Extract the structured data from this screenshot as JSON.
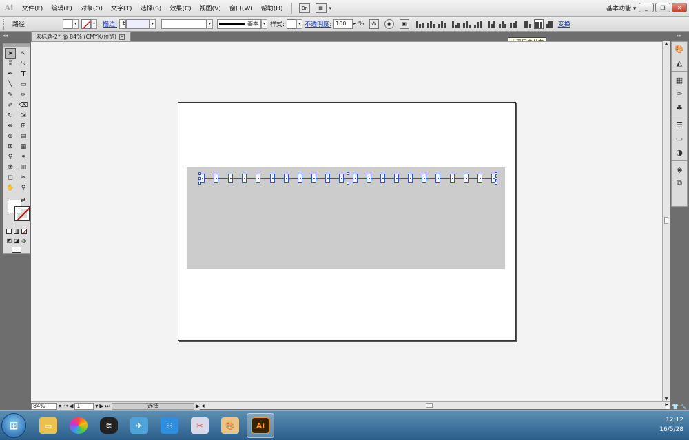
{
  "app": {
    "logo": "Ai"
  },
  "menu": [
    "文件(F)",
    "编辑(E)",
    "对象(O)",
    "文字(T)",
    "选择(S)",
    "效果(C)",
    "视图(V)",
    "窗口(W)",
    "帮助(H)"
  ],
  "menu_icons": [
    "Br",
    "arrange-documents-icon"
  ],
  "workspace": {
    "label": "基本功能",
    "arrow": "▾"
  },
  "window_buttons": [
    "_",
    "❐",
    "✕"
  ],
  "control": {
    "object_type": "路径",
    "stroke_label": "描边:",
    "stroke_style": "基本",
    "style_label": "样式:",
    "opacity_label": "不透明度:",
    "opacity_value": "100",
    "opacity_unit": "%",
    "transform_link": "变换"
  },
  "tooltip": "水平居中分布",
  "doc_tab": {
    "title": "未标题-2* @ 84% (CMYK/预览)",
    "close": "✕"
  },
  "status": {
    "zoom": "84%",
    "page": "1",
    "label": "选择"
  },
  "tools": [
    "selection-tool",
    "direct-selection-tool",
    "magic-wand-tool",
    "lasso-tool",
    "pen-tool",
    "type-tool",
    "line-tool",
    "rectangle-tool",
    "paintbrush-tool",
    "pencil-tool",
    "blob-brush-tool",
    "eraser-tool",
    "rotate-tool",
    "scale-tool",
    "width-tool",
    "free-transform-tool",
    "shape-builder-tool",
    "perspective-grid-tool",
    "mesh-tool",
    "gradient-tool",
    "eyedropper-tool",
    "blend-tool",
    "symbol-sprayer-tool",
    "column-graph-tool",
    "artboard-tool",
    "slice-tool",
    "hand-tool",
    "zoom-tool"
  ],
  "right_panel_icons": [
    "color-icon",
    "color-guide-icon",
    "swatches-icon",
    "brushes-icon",
    "symbols-icon",
    "stroke-icon",
    "gradient-icon",
    "transparency-icon",
    "appearance-icon",
    "layers-icon"
  ],
  "taskbar": {
    "apps": [
      "explorer",
      "colorful-app",
      "wifi-app",
      "bird-app",
      "network-app",
      "paint-app",
      "palette-app",
      "illustrator"
    ],
    "active_app_label": "Ai",
    "time": "12:12",
    "date": "16/5/28"
  },
  "colors": {
    "selection": "#3552d6",
    "artwork_fill": "#cccccc",
    "link": "#1a3fcf"
  }
}
